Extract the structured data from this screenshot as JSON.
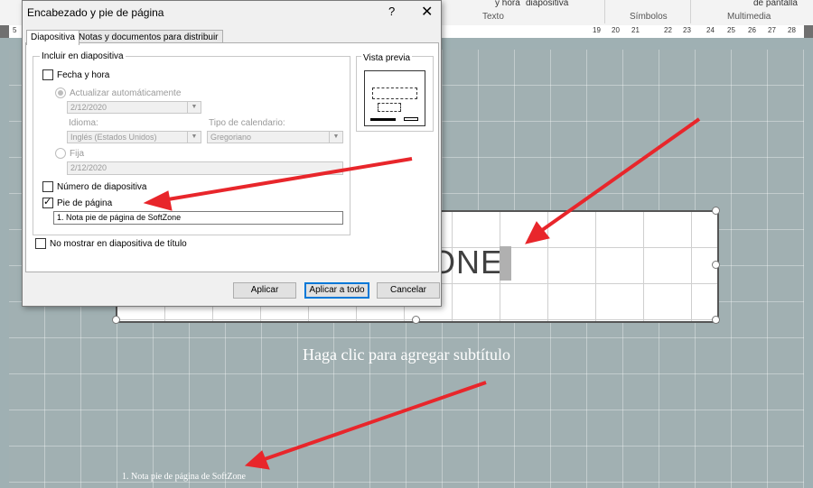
{
  "ribbon": {
    "items": [
      "y hora",
      "diapositiva",
      "de pantalla"
    ],
    "groups": [
      "Texto",
      "Símbolos",
      "Multimedia"
    ]
  },
  "ruler": {
    "ticks": [
      "5",
      "19",
      "20",
      "21",
      "22",
      "23",
      "24",
      "25",
      "26",
      "27",
      "28"
    ]
  },
  "dialog": {
    "title": "Encabezado y pie de página",
    "help": "?",
    "close": "✕",
    "tabs": [
      "Diapositiva",
      "Notas y documentos para distribuir"
    ],
    "include_group": "Incluir en diapositiva",
    "fecha_hora": {
      "label": "Fecha y hora",
      "checked": false
    },
    "actualizar": {
      "label": "Actualizar automáticamente",
      "value": "2/12/2020"
    },
    "idioma": {
      "label": "Idioma:",
      "value": "Inglés (Estados Unidos)"
    },
    "tipo_calendario": {
      "label": "Tipo de calendario:",
      "value": "Gregoriano"
    },
    "fija": {
      "label": "Fija",
      "value": "2/12/2020"
    },
    "numero": {
      "label": "Número de diapositiva",
      "checked": false
    },
    "pie": {
      "label": "Pie de página",
      "checked": true,
      "value": "1. Nota pie de página de SoftZone"
    },
    "no_mostrar": {
      "label": "No mostrar en diapositiva de título",
      "checked": false
    },
    "preview_label": "Vista previa",
    "buttons": {
      "aplicar": "Aplicar",
      "aplicar_todo": "Aplicar a todo",
      "cancelar": "Cancelar"
    }
  },
  "slide": {
    "title_fragment": "ONE",
    "subtitle": "Haga clic para agregar subtítulo",
    "footer": "1. Nota pie de página de SoftZone"
  },
  "colors": {
    "slide_bg": "#a1b0b2",
    "arrow": "#e8262b",
    "accent": "#0078d7"
  }
}
